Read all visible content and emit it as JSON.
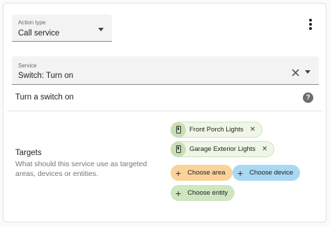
{
  "action_type": {
    "label": "Action type",
    "value": "Call service"
  },
  "service": {
    "label": "Service",
    "value": "Switch: Turn on"
  },
  "service_description": "Turn a switch on",
  "help_icon": "?",
  "targets": {
    "title": "Targets",
    "description": "What should this service use as targeted areas, devices or entities.",
    "selected": [
      {
        "label": "Front Porch Lights",
        "icon": "switch-icon"
      },
      {
        "label": "Garage Exterior Lights",
        "icon": "switch-icon"
      }
    ],
    "add_buttons": {
      "area": "Choose area",
      "device": "Choose device",
      "entity": "Choose entity"
    }
  },
  "colors": {
    "area_chip": "#f9d39a",
    "device_chip": "#a9d8f2",
    "entity_chip": "#cfe6c0",
    "field_background": "#f3f3f3"
  }
}
